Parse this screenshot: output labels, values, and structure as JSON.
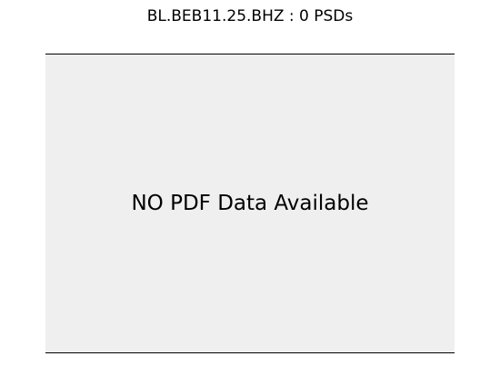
{
  "chart_data": {
    "type": "line",
    "title": "BL.BEB11.25.BHZ : 0 PSDs",
    "message": "NO PDF Data Available",
    "series": [],
    "background_color": "#efefef",
    "grid": false
  }
}
